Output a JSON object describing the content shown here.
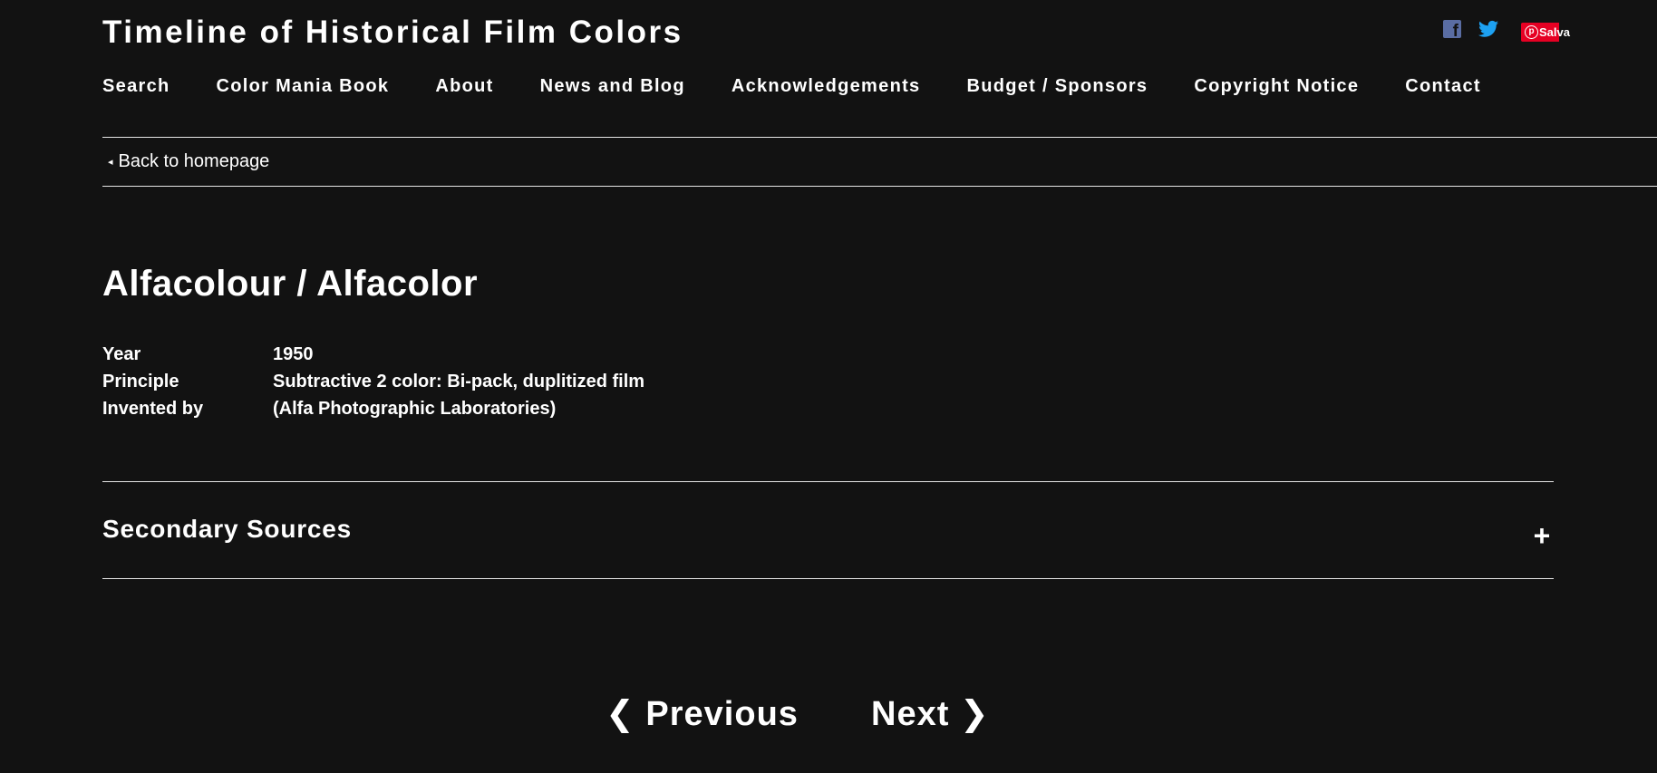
{
  "site": {
    "title": "Timeline of Historical Film Colors"
  },
  "social": {
    "facebook_icon": "facebook-icon",
    "twitter_icon": "twitter-icon",
    "pinterest_label": "Salva",
    "colors": {
      "facebook": "#5a6da3",
      "twitter": "#1da1f2",
      "pinterest": "#e60023"
    }
  },
  "nav": {
    "items": [
      {
        "label": "Search"
      },
      {
        "label": "Color Mania Book"
      },
      {
        "label": "About"
      },
      {
        "label": "News and Blog"
      },
      {
        "label": "Acknowledgements"
      },
      {
        "label": "Budget / Sponsors"
      },
      {
        "label": "Copyright Notice"
      },
      {
        "label": "Contact"
      }
    ]
  },
  "back_link": {
    "arrow": "◂",
    "label": "Back to homepage"
  },
  "entry": {
    "title": "Alfacolour / Alfacolor",
    "details": [
      {
        "key": "Year",
        "value": "1950"
      },
      {
        "key": "Principle",
        "value": "Subtractive 2 color: Bi-pack, duplitized film"
      },
      {
        "key": "Invented by",
        "value": "(Alfa Photographic Laboratories)"
      }
    ]
  },
  "secondary_sources": {
    "title": "Secondary Sources",
    "toggle": "+"
  },
  "pager": {
    "previous": "❮ Previous",
    "next": "Next ❯"
  },
  "theme": {
    "background": "#121212",
    "text": "#ffffff"
  }
}
